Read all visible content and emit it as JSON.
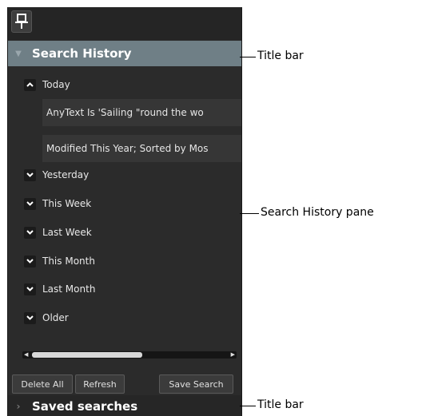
{
  "pane": {
    "search_history_title": "Search History",
    "groups": [
      {
        "label": "Today",
        "expanded": true
      },
      {
        "label": "Yesterday",
        "expanded": false
      },
      {
        "label": "This Week",
        "expanded": false
      },
      {
        "label": "Last Week",
        "expanded": false
      },
      {
        "label": "This Month",
        "expanded": false
      },
      {
        "label": "Last Month",
        "expanded": false
      },
      {
        "label": "Older",
        "expanded": false
      }
    ],
    "today_items": [
      "AnyText Is 'Sailing \"round the wo",
      "Modified This Year; Sorted by Mos"
    ],
    "buttons": {
      "delete_all": "Delete All",
      "refresh": "Refresh",
      "save_search": "Save Search"
    },
    "saved_searches_title": "Saved searches"
  },
  "annotations": {
    "title_bar_top": "Title bar",
    "pane": "Search History pane",
    "title_bar_bottom": "Title bar"
  }
}
